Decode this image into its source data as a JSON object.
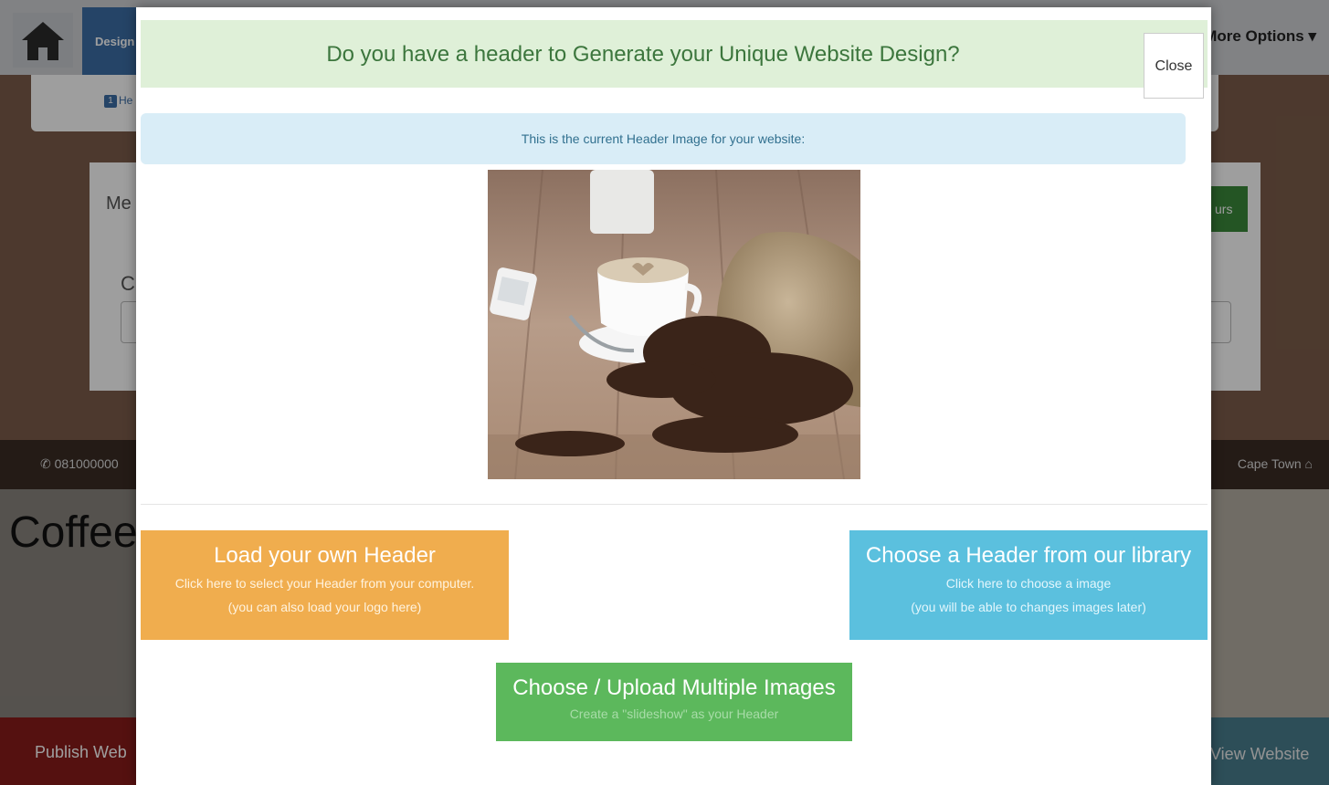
{
  "background": {
    "design_tab": "Design",
    "more_options": "More Options ▾",
    "steps": {
      "number": "1",
      "label": "He"
    },
    "menu_card": {
      "title": "Me",
      "field_label": "C"
    },
    "green_button_fragment": "urs",
    "contact": {
      "phone": "081000000",
      "town": "Cape Town"
    },
    "hero_title": "Coffee",
    "footer": {
      "publish": "Publish Web",
      "view": "View Website"
    }
  },
  "modal": {
    "title": "Do you have a header to Generate your Unique Website Design?",
    "close_label": "Close",
    "info_text": "This is the current Header Image for your website:",
    "buttons": {
      "load_own": {
        "title": "Load your own Header",
        "line1": "Click here to select your Header from your computer.",
        "line2": "(you can also load your logo here)"
      },
      "library": {
        "title": "Choose a Header from our library",
        "line1": "Click here to choose a image",
        "line2": "(you will be able to changes images later)"
      },
      "multiple": {
        "title": "Choose / Upload Multiple Images",
        "line1": "Create a \"slideshow\" as your Header"
      }
    }
  },
  "colors": {
    "header_bg": "#dff0d8",
    "title_text": "#3c763d",
    "info_bg": "#d9edf7",
    "orange": "#f0ad4e",
    "blue": "#5bc0de",
    "green": "#5cb85c"
  }
}
